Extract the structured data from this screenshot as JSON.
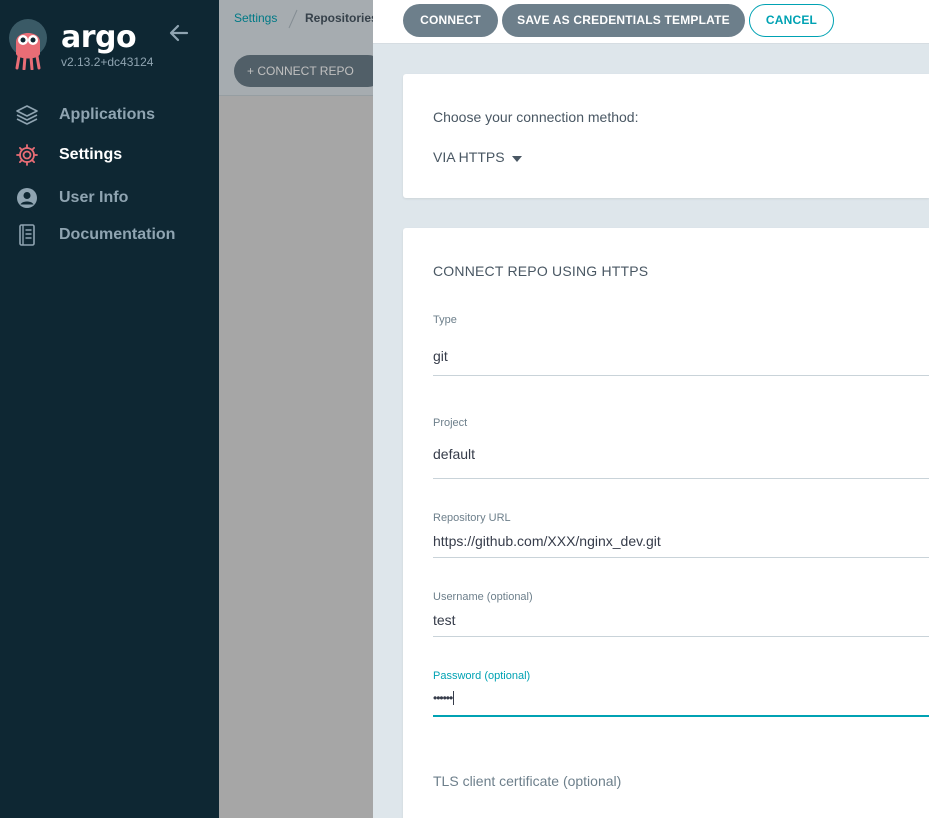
{
  "sidebar": {
    "brand": "argo",
    "version": "v2.13.2+dc43124",
    "items": [
      {
        "label": "Applications",
        "icon": "layers-icon"
      },
      {
        "label": "Settings",
        "icon": "gear-icon"
      },
      {
        "label": "User Info",
        "icon": "user-icon"
      },
      {
        "label": "Documentation",
        "icon": "book-icon"
      }
    ]
  },
  "breadcrumb": {
    "settings": "Settings",
    "repositories": "Repositories"
  },
  "toolbar": {
    "connect_repo": "+ CONNECT REPO"
  },
  "panel": {
    "buttons": {
      "connect": "CONNECT",
      "save_template": "SAVE AS CREDENTIALS TEMPLATE",
      "cancel": "CANCEL"
    },
    "method": {
      "label": "Choose your connection method:",
      "selected": "VIA HTTPS"
    },
    "form": {
      "title": "CONNECT REPO USING HTTPS",
      "type": {
        "label": "Type",
        "value": "git"
      },
      "project": {
        "label": "Project",
        "value": "default"
      },
      "repo_url": {
        "label": "Repository URL",
        "value": "https://github.com/XXX/nginx_dev.git"
      },
      "username": {
        "label": "Username (optional)",
        "value": "test"
      },
      "password": {
        "label": "Password (optional)",
        "value": "••••••"
      },
      "tls_cert": {
        "label": "TLS client certificate (optional)"
      }
    }
  },
  "colors": {
    "sidebar_bg": "#0e2733",
    "accent": "#00a2b3",
    "button_dark": "#6d7f8b"
  }
}
